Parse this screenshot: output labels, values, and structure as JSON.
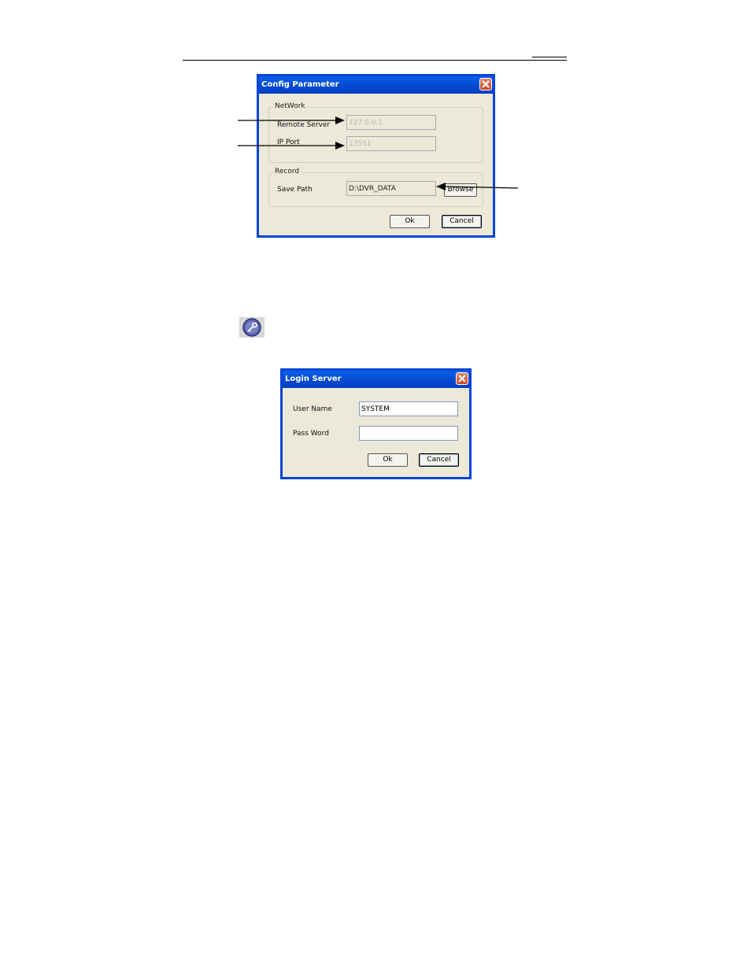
{
  "config_dialog": {
    "title": "Config Parameter",
    "network_group": "NetWork",
    "remote_server_label": "Remote Server",
    "remote_server_value": "127.0.0.1",
    "ip_port_label": "IP Port",
    "ip_port_value": "13551",
    "record_group": "Record",
    "save_path_label": "Save Path",
    "save_path_value": "D:\\DVR_DATA",
    "browse_label": "Browse",
    "ok_label": "Ok",
    "cancel_label": "Cancel"
  },
  "login_dialog": {
    "title": "Login Server",
    "user_name_label": "User Name",
    "user_name_value": "SYSTEM",
    "password_label": "Pass Word",
    "password_value": "",
    "ok_label": "Ok",
    "cancel_label": "Cancel"
  },
  "icons": {
    "login_key": "key-icon",
    "close": "close-icon"
  },
  "colors": {
    "titlebar": "#0a5fe8",
    "dialog_bg": "#ece9d8",
    "close_button": "#c94422"
  }
}
